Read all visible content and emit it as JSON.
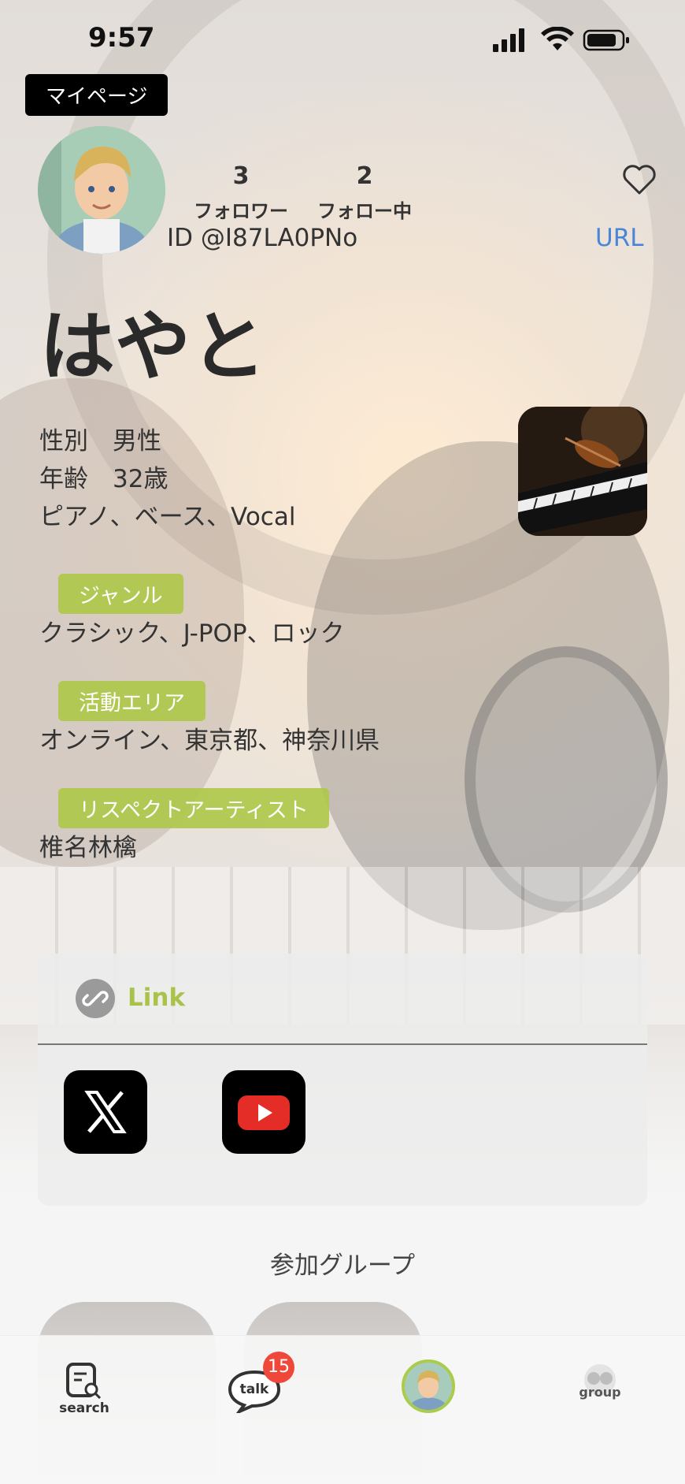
{
  "status_bar": {
    "time": "9:57"
  },
  "header": {
    "page_label": "マイページ"
  },
  "profile": {
    "followers_count": "3",
    "followers_label": "フォロワー",
    "following_count": "2",
    "following_label": "フォロー中",
    "user_id": "ID @I87LA0PNo",
    "url_label": "URL",
    "name": "はやと",
    "gender": "性別　男性",
    "age": "年齢　32歳",
    "instruments": "ピアノ、ベース、Vocal"
  },
  "sections": [
    {
      "label": "ジャンル",
      "value": "クラシック、J-POP、ロック"
    },
    {
      "label": "活動エリア",
      "value": "オンライン、東京都、神奈川県"
    },
    {
      "label": "リスペクトアーティスト",
      "value": "椎名林檎"
    }
  ],
  "links": {
    "title": "Link",
    "items": [
      "x-icon",
      "youtube-icon"
    ]
  },
  "groups": {
    "title": "参加グループ"
  },
  "tabbar": {
    "search_label": "search",
    "talk_label": "talk",
    "talk_badge": "15",
    "group_label": "group"
  },
  "colors": {
    "accent": "#aec848",
    "url": "#4a86d8",
    "badge": "#f0473b"
  }
}
